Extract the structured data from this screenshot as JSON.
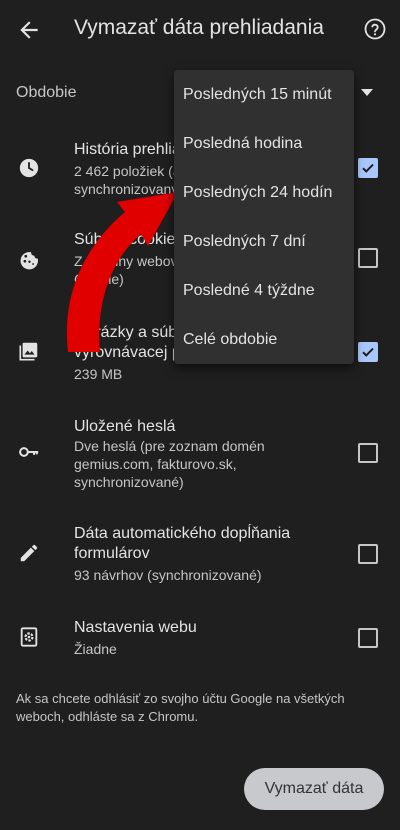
{
  "header": {
    "title": "Vymazať dáta prehliadania",
    "back_icon": "arrow-back-icon",
    "help_icon": "help-circle-icon"
  },
  "period": {
    "label": "Obdobie",
    "options": [
      "Posledných 15 minút",
      "Posledná hodina",
      "Posledných 24 hodín",
      "Posledných 7 dní",
      "Posledné 4 týždne",
      "Celé obdobie"
    ]
  },
  "items": [
    {
      "key": "history",
      "icon": "clock-icon",
      "title": "História prehliadania",
      "subtitle": "2 462 položiek (a ďalšie na synchronizovaných zariadeniach)",
      "checked": true
    },
    {
      "key": "cookies",
      "icon": "cookie-icon",
      "title": "Súbory cookie a dáta webov",
      "subtitle": "Z väčšiny webov (neodhlási vás z účtu Google)",
      "checked": false
    },
    {
      "key": "images",
      "icon": "image-icon",
      "title": "Obrázky a súbory uložené vo vyrovnávacej pamäti",
      "subtitle": "239 MB",
      "checked": true
    },
    {
      "key": "passwords",
      "icon": "key-icon",
      "title": "Uložené heslá",
      "subtitle": "Dve heslá (pre zoznam domén gemius.com, fakturovo.sk, synchronizované)",
      "checked": false
    },
    {
      "key": "autofill",
      "icon": "pencil-icon",
      "title": "Dáta automatického dopĺňania formulárov",
      "subtitle": "93 návrhov (synchronizované)",
      "checked": false
    },
    {
      "key": "site_settings",
      "icon": "site-settings-icon",
      "title": "Nastavenia webu",
      "subtitle": "Žiadne",
      "checked": false
    }
  ],
  "footer": {
    "note": "Ak sa chcete odhlásiť zo svojho účtu Google na všetkých weboch, odhláste sa z Chromu.",
    "clear_button": "Vymazať dáta"
  },
  "colors": {
    "background": "#1f1f1f",
    "checkbox_checked": "#a8c7fa",
    "annotation_arrow": "#e00000"
  }
}
